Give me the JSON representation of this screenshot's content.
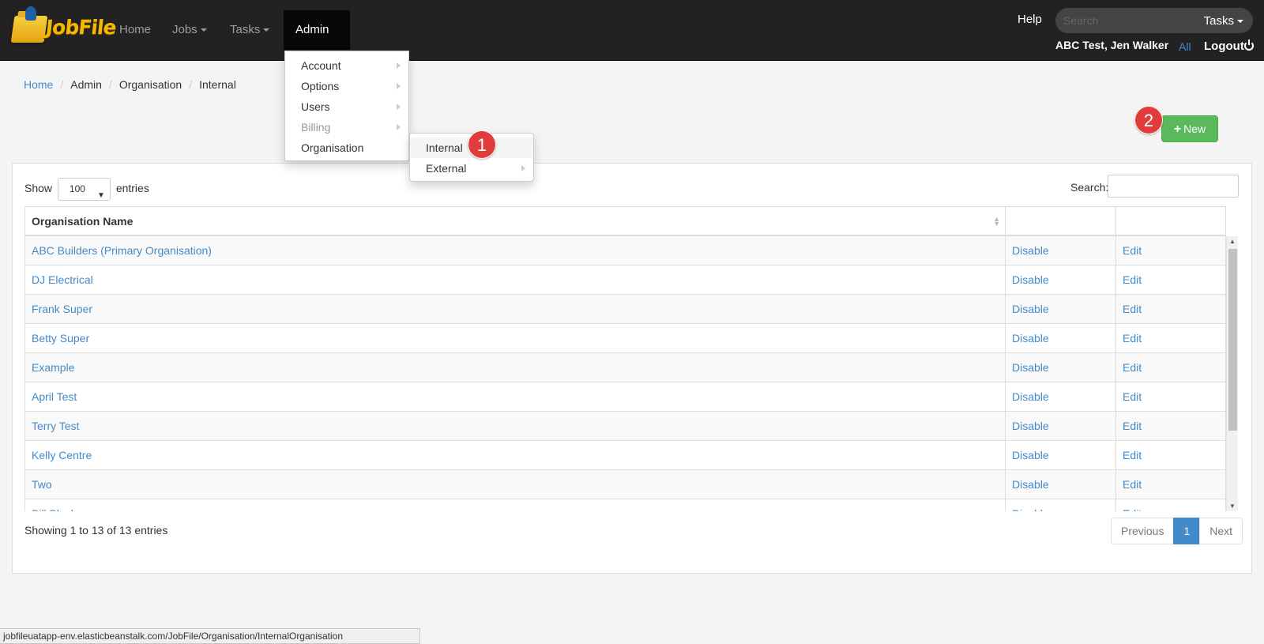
{
  "app": {
    "logo_text": "JobFile"
  },
  "nav": {
    "items": [
      {
        "label": "Home"
      },
      {
        "label": "Jobs"
      },
      {
        "label": "Tasks"
      },
      {
        "label": "Admin"
      }
    ],
    "help": "Help",
    "search_placeholder": "Search",
    "search_scope": "Tasks",
    "user": "ABC Test, Jen Walker",
    "all": "All",
    "logout": "Logout"
  },
  "admin_menu": {
    "items": [
      {
        "label": "Account"
      },
      {
        "label": "Options"
      },
      {
        "label": "Users"
      },
      {
        "label": "Billing"
      },
      {
        "label": "Organisation"
      }
    ]
  },
  "org_submenu": {
    "items": [
      {
        "label": "Internal"
      },
      {
        "label": "External"
      }
    ]
  },
  "annotations": {
    "step1": "1",
    "step2": "2"
  },
  "breadcrumb": [
    "Home",
    "Admin",
    "Organisation",
    "Internal"
  ],
  "new_button": "New",
  "table_controls": {
    "show": "Show",
    "entries_value": "100",
    "entries": "entries",
    "search_label": "Search:"
  },
  "table": {
    "header": "Organisation Name",
    "rows": [
      {
        "name": "ABC Builders (Primary Organisation)",
        "disable": "Disable",
        "edit": "Edit"
      },
      {
        "name": "DJ Electrical",
        "disable": "Disable",
        "edit": "Edit"
      },
      {
        "name": "Frank Super",
        "disable": "Disable",
        "edit": "Edit"
      },
      {
        "name": "Betty Super",
        "disable": "Disable",
        "edit": "Edit"
      },
      {
        "name": "Example",
        "disable": "Disable",
        "edit": "Edit"
      },
      {
        "name": "April Test",
        "disable": "Disable",
        "edit": "Edit"
      },
      {
        "name": "Terry Test",
        "disable": "Disable",
        "edit": "Edit"
      },
      {
        "name": "Kelly Centre",
        "disable": "Disable",
        "edit": "Edit"
      },
      {
        "name": "Two",
        "disable": "Disable",
        "edit": "Edit"
      },
      {
        "name": "Bill Black",
        "disable": "Disable",
        "edit": "Edit"
      }
    ]
  },
  "footer": {
    "showing": "Showing 1 to 13 of 13 entries",
    "previous": "Previous",
    "page": "1",
    "next": "Next"
  },
  "status_url": "jobfileuatapp-env.elasticbeanstalk.com/JobFile/Organisation/InternalOrganisation"
}
